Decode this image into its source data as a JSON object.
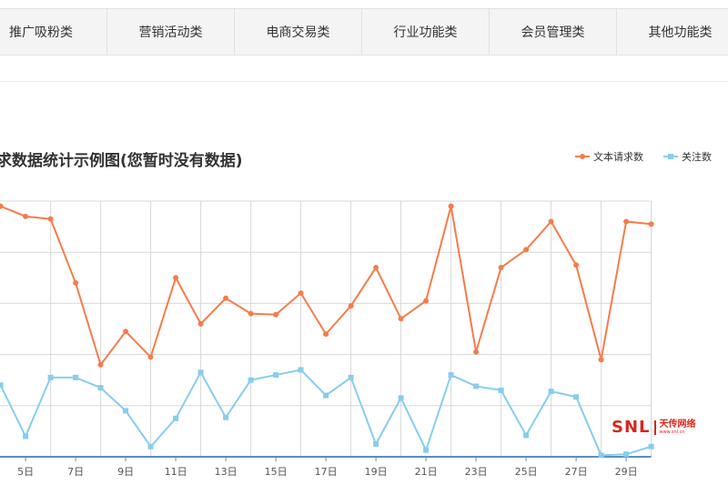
{
  "tabs": [
    {
      "label": "推广吸粉类"
    },
    {
      "label": "营销活动类"
    },
    {
      "label": "电商交易类"
    },
    {
      "label": "行业功能类"
    },
    {
      "label": "会员管理类"
    },
    {
      "label": "其他功能类"
    }
  ],
  "logo": {
    "mark": "SNL",
    "name": "天传网络",
    "sub": "www.snl.cn"
  },
  "chart_data": {
    "type": "line",
    "title": "求数据统计示例图(您暂时没有数据)",
    "x": [
      4,
      5,
      6,
      7,
      8,
      9,
      10,
      11,
      12,
      13,
      14,
      15,
      16,
      17,
      18,
      19,
      20,
      21,
      22,
      23,
      24,
      25,
      26,
      27,
      28,
      29,
      30
    ],
    "x_tick_labels": [
      "5日",
      "7日",
      "9日",
      "11日",
      "13日",
      "15日",
      "17日",
      "19日",
      "21日",
      "23日",
      "25日",
      "27日",
      "29日"
    ],
    "x_tick_values": [
      5,
      7,
      9,
      11,
      13,
      15,
      17,
      19,
      21,
      23,
      25,
      27,
      29
    ],
    "ylim": [
      0,
      5
    ],
    "legend_position": "top-right",
    "grid": true,
    "series": [
      {
        "name": "文本请求数",
        "color": "#f47c4c",
        "values": [
          4.9,
          4.7,
          4.65,
          3.4,
          1.8,
          2.45,
          1.95,
          3.5,
          2.6,
          3.1,
          2.8,
          2.78,
          3.2,
          2.4,
          2.95,
          3.7,
          2.7,
          3.05,
          4.9,
          2.05,
          3.7,
          4.05,
          4.6,
          3.75,
          1.9,
          4.6,
          4.55
        ]
      },
      {
        "name": "关注数",
        "color": "#87cdee",
        "values": [
          1.4,
          0.4,
          1.55,
          1.55,
          1.35,
          0.9,
          0.2,
          0.75,
          1.65,
          0.77,
          1.5,
          1.6,
          1.7,
          1.2,
          1.55,
          0.25,
          1.15,
          0.13,
          1.6,
          1.38,
          1.3,
          0.42,
          1.28,
          1.17,
          0.03,
          0.05,
          0.2
        ]
      }
    ]
  }
}
